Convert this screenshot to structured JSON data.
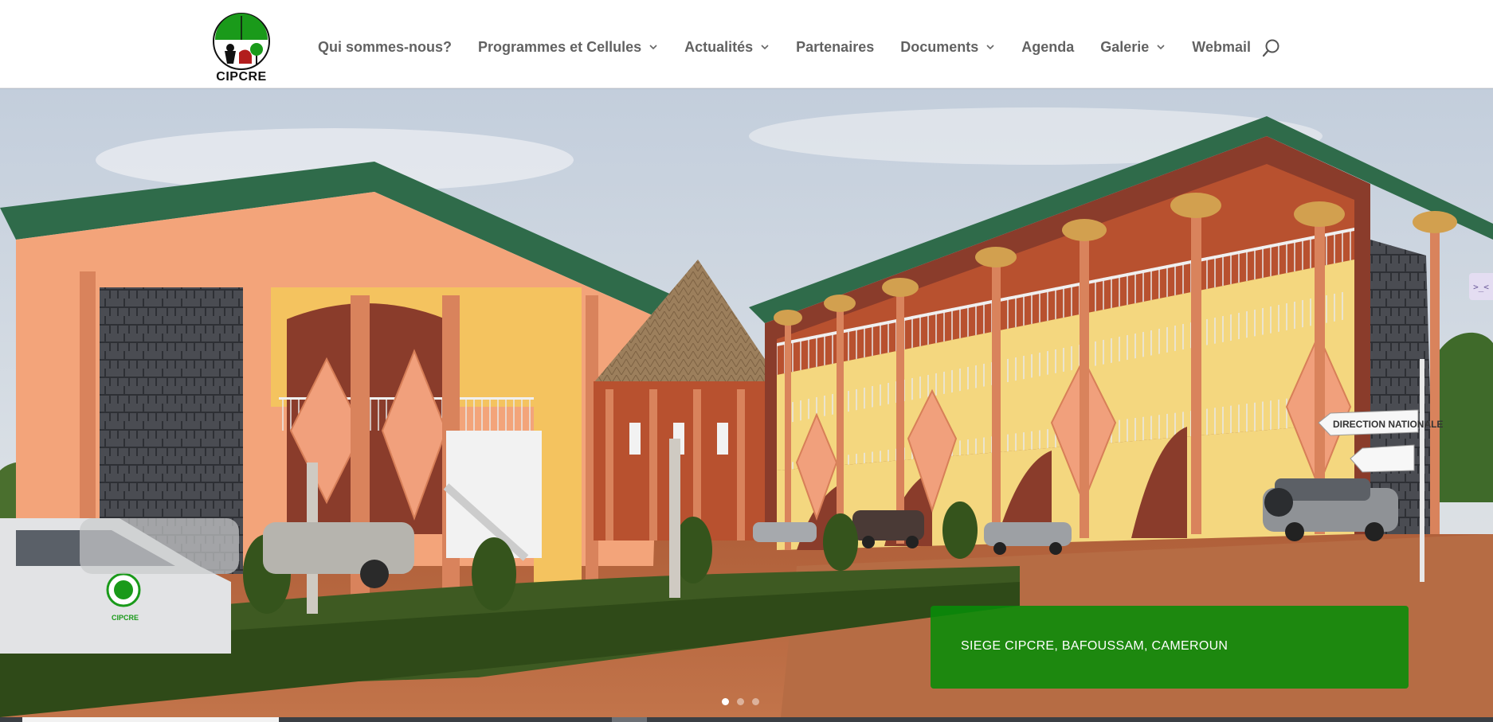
{
  "brand": {
    "logo_text": "CIPCRE",
    "colors": {
      "green": "#1a9a1a",
      "red": "#b21d1d",
      "black": "#111111"
    }
  },
  "nav": {
    "items": [
      {
        "label": "Qui sommes-nous?",
        "has_dropdown": false
      },
      {
        "label": "Programmes et Cellules",
        "has_dropdown": true
      },
      {
        "label": "Actualités",
        "has_dropdown": true
      },
      {
        "label": "Partenaires",
        "has_dropdown": false
      },
      {
        "label": "Documents",
        "has_dropdown": true
      },
      {
        "label": "Agenda",
        "has_dropdown": false
      },
      {
        "label": "Galerie",
        "has_dropdown": true
      },
      {
        "label": "Webmail",
        "has_dropdown": false
      }
    ],
    "search_icon": "search-icon"
  },
  "hero": {
    "caption": "SIEGE CIPCRE, BAFOUSSAM, CAMEROUN",
    "caption_bg": "#0a8c0a",
    "slides_count": 3,
    "active_slide": 1,
    "signpost": "DIRECTION NATIONALE",
    "vehicle_badge": "CIPCRE"
  },
  "side_toggle": {
    "icon": "collapse-icon",
    "label": ">_<"
  }
}
